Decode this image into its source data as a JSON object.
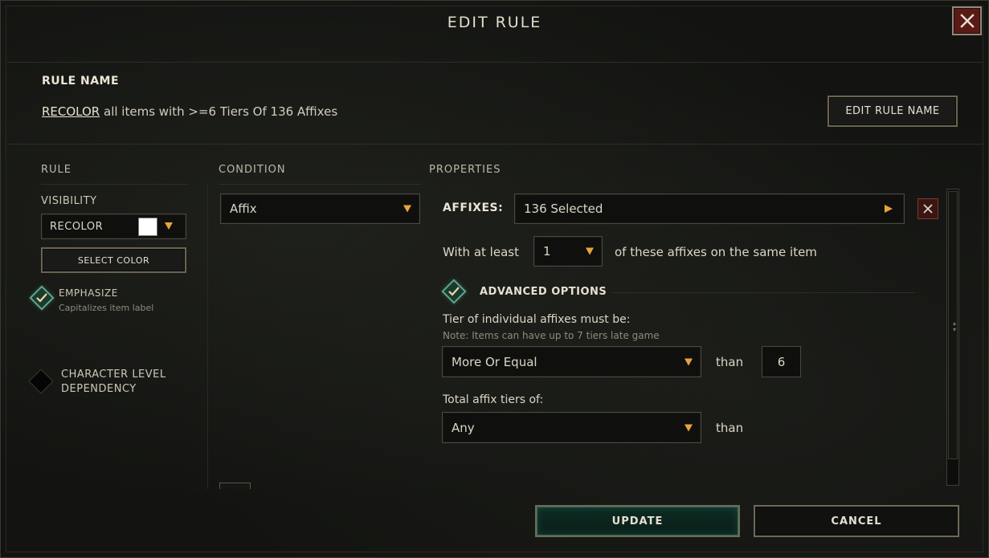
{
  "dialog": {
    "title": "EDIT RULE"
  },
  "rule_name": {
    "heading": "RULE NAME",
    "action": "RECOLOR",
    "description": "all items with >=6 Tiers Of 136 Affixes",
    "edit_button": "EDIT RULE NAME"
  },
  "columns": {
    "rule": "RULE",
    "condition": "CONDITION",
    "properties": "PROPERTIES"
  },
  "rule": {
    "visibility_label": "VISIBILITY",
    "visibility_value": "RECOLOR",
    "swatch_color": "#ffffff",
    "select_color_button": "SELECT COLOR",
    "emphasize_label": "EMPHASIZE",
    "emphasize_sub": "Capitalizes item label",
    "emphasize_checked": true,
    "char_level_label_1": "CHARACTER LEVEL",
    "char_level_label_2": "DEPENDENCY",
    "char_level_checked": false
  },
  "condition": {
    "type_value": "Affix"
  },
  "properties": {
    "affixes_label": "AFFIXES:",
    "affixes_value": "136 Selected",
    "with_at_least": "With at least",
    "count_value": "1",
    "count_suffix": "of these affixes on the same item",
    "advanced_label": "ADVANCED OPTIONS",
    "advanced_checked": true,
    "tier_label": "Tier of individual affixes must be:",
    "tier_note": "Note: Items can have up to 7 tiers late game",
    "tier_comparison": "More Or Equal",
    "than_1": "than",
    "tier_value": "6",
    "total_label": "Total affix tiers of:",
    "total_comparison": "Any",
    "than_2": "than"
  },
  "footer": {
    "update_button": "UPDATE",
    "cancel_button": "CANCEL"
  },
  "colors": {
    "accent_orange": "#e8a43a",
    "checked_green": "#5fa58c",
    "close_red": "#5a1a16"
  }
}
